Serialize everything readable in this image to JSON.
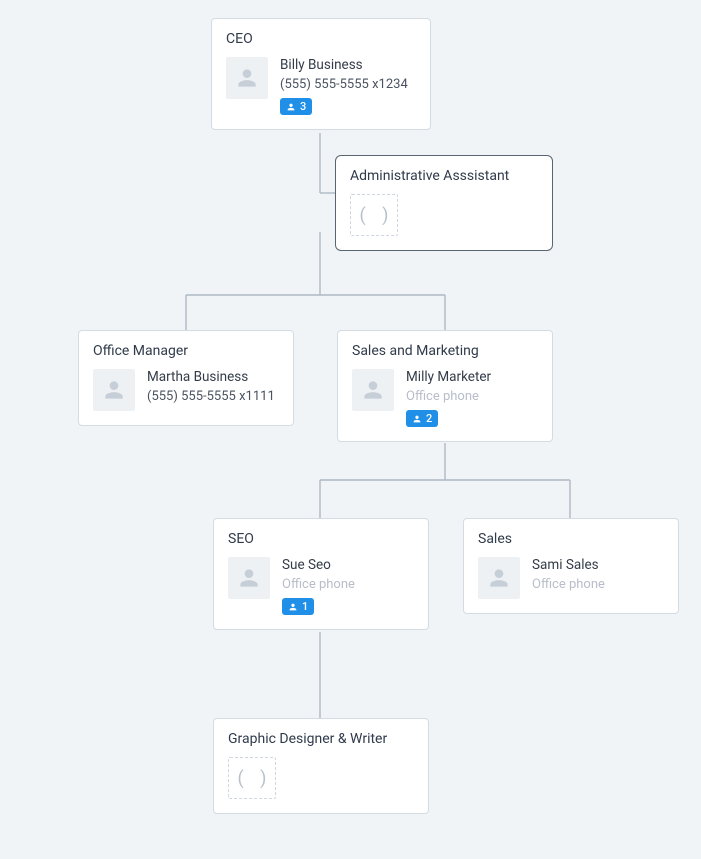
{
  "org": {
    "ceo": {
      "title": "CEO",
      "name": "Billy Business",
      "phone": "(555) 555-5555 x1234",
      "reports": "3"
    },
    "admin": {
      "title": "Administrative Asssistant",
      "placeholder": "(   )"
    },
    "office_manager": {
      "title": "Office Manager",
      "name": "Martha Business",
      "phone": "(555) 555-5555 x1111"
    },
    "sales_marketing": {
      "title": "Sales and Marketing",
      "name": "Milly Marketer",
      "phone": "Office phone",
      "reports": "2"
    },
    "seo": {
      "title": "SEO",
      "name": "Sue Seo",
      "phone": "Office phone",
      "reports": "1"
    },
    "sales": {
      "title": "Sales",
      "name": "Sami Sales",
      "phone": "Office phone"
    },
    "designer": {
      "title": "Graphic Designer & Writer",
      "placeholder": "(   )"
    }
  }
}
